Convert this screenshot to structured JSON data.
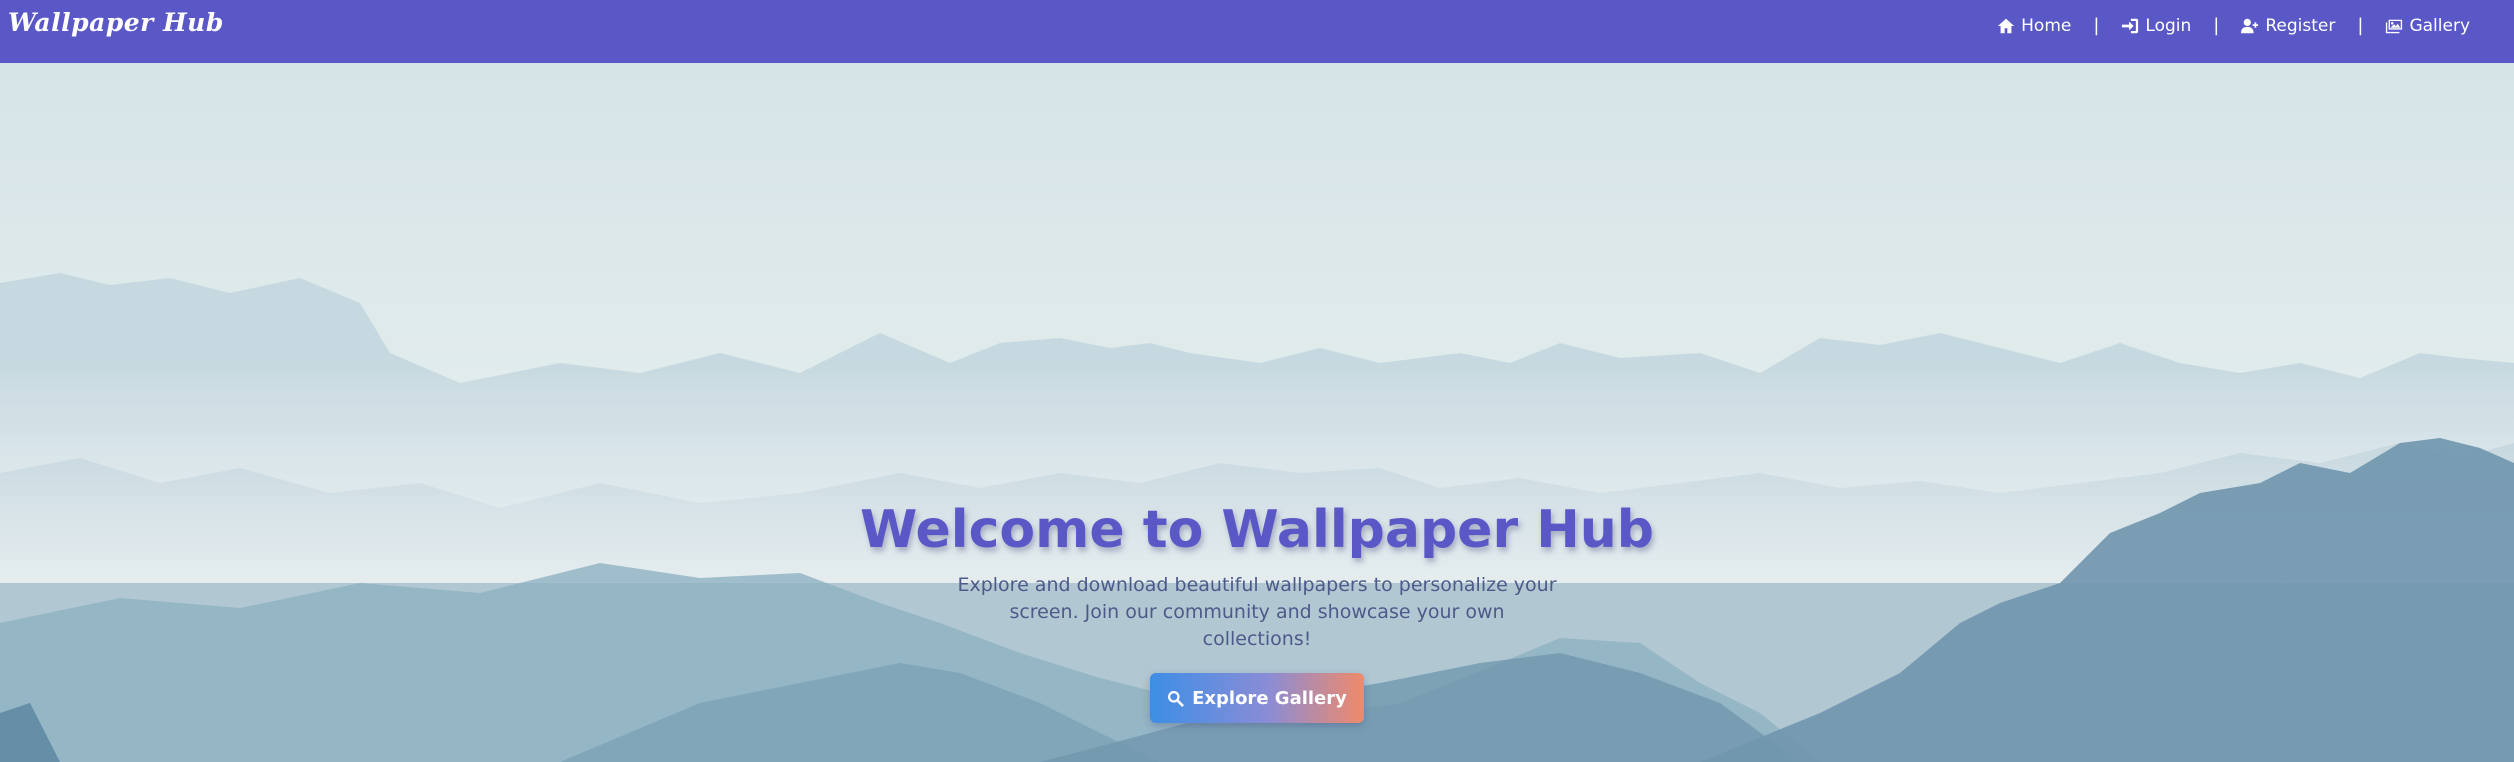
{
  "navbar": {
    "brand": "Wallpaper Hub",
    "links": [
      {
        "label": "Home",
        "icon": "home-icon"
      },
      {
        "label": "Login",
        "icon": "sign-in-icon"
      },
      {
        "label": "Register",
        "icon": "user-plus-icon"
      },
      {
        "label": "Gallery",
        "icon": "images-icon"
      }
    ],
    "separator": "|"
  },
  "hero": {
    "title": "Welcome to Wallpaper Hub",
    "subtitle": "Explore and download beautiful wallpapers to personalize your screen. Join our community and showcase your own collections!",
    "cta_label": "Explore Gallery",
    "cta_icon": "search-icon",
    "background": "misty-mountains-image"
  },
  "colors": {
    "navbar": "#5a58c6",
    "title": "#5a58c6",
    "subtitle": "#4c5a8a",
    "cta_gradient_start": "#3d8ee6",
    "cta_gradient_end": "#ef8a6a"
  }
}
